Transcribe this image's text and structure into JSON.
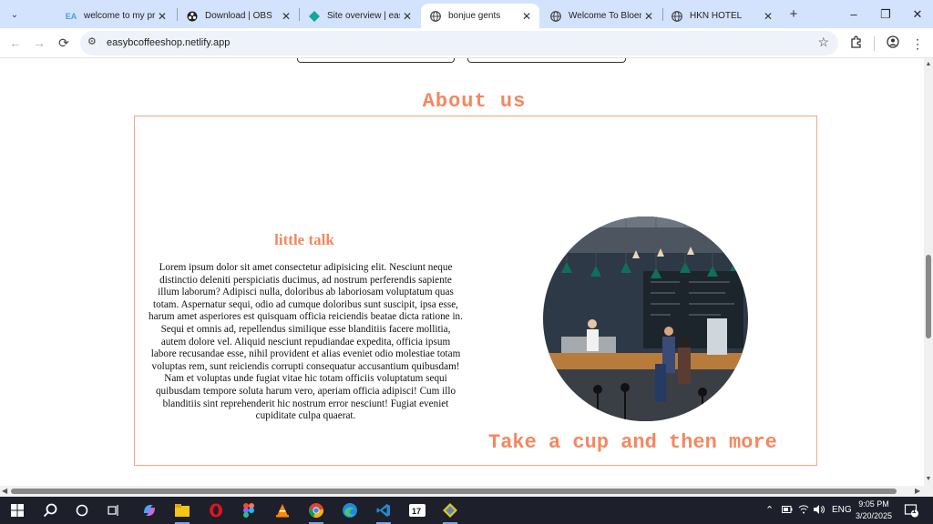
{
  "browser": {
    "tabs": [
      {
        "title": "welcome to my pro",
        "favicon": "ea-favicon",
        "active": false
      },
      {
        "title": "Download | OBS",
        "favicon": "obs-icon",
        "active": false
      },
      {
        "title": "Site overview | easy",
        "favicon": "netlify-icon",
        "active": false
      },
      {
        "title": "bonjue gents",
        "favicon": "globe-icon",
        "active": true
      },
      {
        "title": "Welcome To Bloemf",
        "favicon": "globe-icon",
        "active": false
      },
      {
        "title": "HKN HOTEL",
        "favicon": "globe-icon",
        "active": false
      }
    ],
    "url": "easybcoffeeshop.netlify.app",
    "window_buttons": {
      "minimize": "–",
      "restore": "❐",
      "close": "✕"
    }
  },
  "page": {
    "about_title": "About us",
    "talk_title": "little talk",
    "talk_body": "Lorem ipsum dolor sit amet consectetur adipisicing elit. Nesciunt neque distinctio deleniti perspiciatis ducimus, ad nostrum perferendis sapiente illum laborum? Adipisci nulla, doloribus ab laboriosam voluptatum quas totam. Aspernatur sequi, odio ad cumque doloribus sunt suscipit, ipsa esse, harum amet asperiores est quisquam officia reiciendis beatae dicta ratione in. Sequi et omnis ad, repellendus similique esse blanditiis facere mollitia, autem dolore vel. Aliquid nesciunt repudiandae expedita, officia ipsum labore recusandae esse, nihil provident et alias eveniet odio molestiae totam voluptas rem, sunt reiciendis corrupti consequatur accusantium quibusdam! Nam et voluptas unde fugiat vitae hic totam officiis voluptatum sequi quibusdam tempore soluta harum vero, aperiam officia adipisci! Cum illo blanditiis sint reprehenderit hic nostrum error nesciunt! Fugiat eveniet cupiditate culpa quaerat.",
    "tagline": "Take a cup and then more",
    "accent_color": "#f48760"
  },
  "taskbar": {
    "language": "ENG",
    "time": "9:05 PM",
    "date": "3/20/2025",
    "notification_count": "1"
  }
}
